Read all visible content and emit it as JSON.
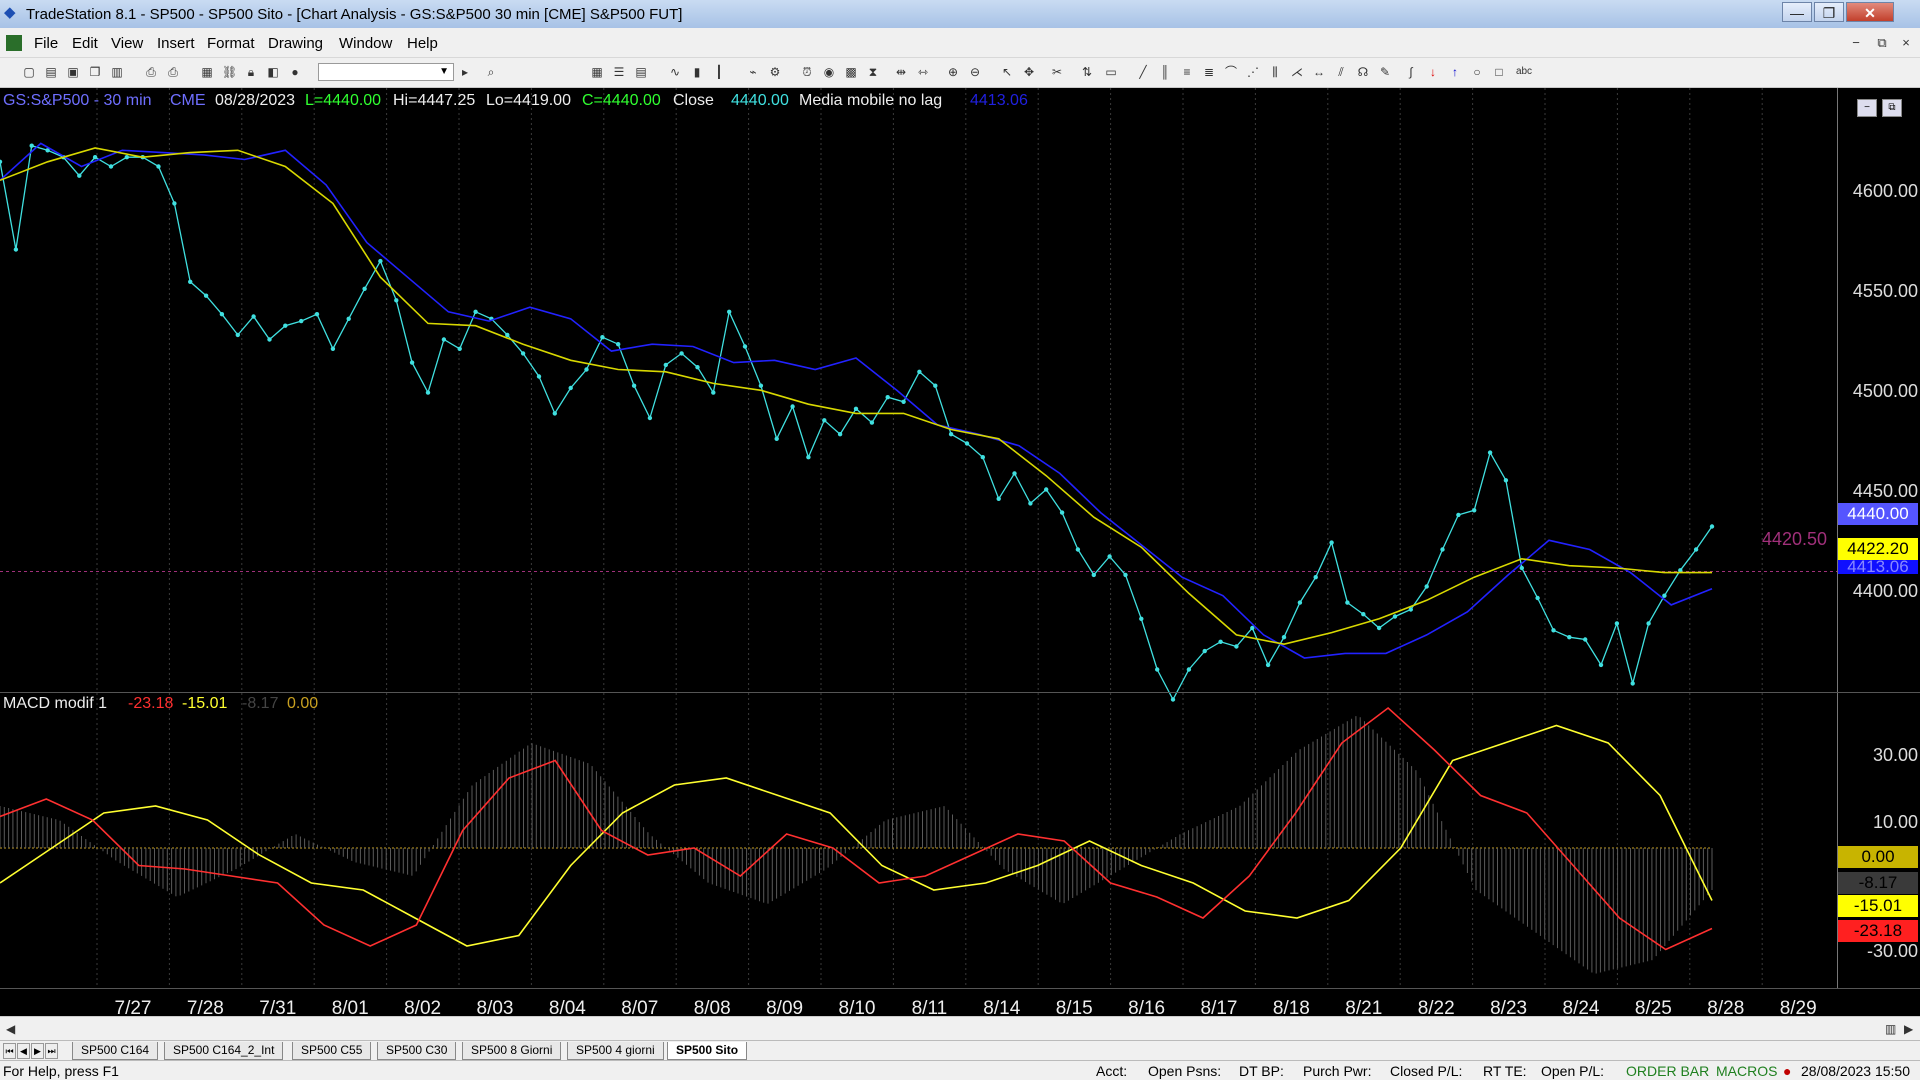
{
  "window": {
    "title": "TradeStation 8.1 - SP500 - SP500 Sito - [Chart Analysis - GS:S&P500  30 min  [CME] S&P500 FUT]",
    "controls": {
      "minimize": "—",
      "restore": "❐",
      "close": "✕"
    }
  },
  "menu": {
    "items": [
      "File",
      "Edit",
      "View",
      "Insert",
      "Format",
      "Drawing",
      "Window",
      "Help"
    ],
    "mdi_controls": [
      "−",
      "⧉",
      "×"
    ]
  },
  "toolbar": {
    "combo_value": ""
  },
  "chart_header": {
    "symbol": "GS:S&P500 - 30 min",
    "exchange": "CME",
    "date": "08/28/2023",
    "last": "L=4440.00",
    "high": "Hi=4447.25",
    "low": "Lo=4419.00",
    "close_val": "C=4440.00",
    "close_label": "Close",
    "close_num": "4440.00",
    "ma_label": "Media mobile no lag",
    "ma_value": "4413.06",
    "colors": {
      "symbol": "#6f6fff",
      "last": "#30ff30",
      "close_val": "#30ff30",
      "close_num": "#40e0e0",
      "ma_value": "#2020e0"
    }
  },
  "macd_header": {
    "name": "MACD modif 1",
    "macd": "-23.18",
    "signal": "-15.01",
    "hist": "-8.17",
    "zero": "0.00",
    "colors": {
      "macd": "#ff3030",
      "signal": "#ffff30",
      "hist": "#444444",
      "zero": "#c8a020"
    }
  },
  "price_axis": {
    "labels": [
      "4600.00",
      "4550.00",
      "4500.00",
      "4450.00",
      "4400.00"
    ],
    "boxes": {
      "last": "4440.00",
      "ma_slow": "4422.20",
      "ma_fast": "4413.06"
    },
    "marker": "4420.50"
  },
  "macd_axis": {
    "labels": [
      "30.00",
      "10.00",
      "-30.00"
    ],
    "boxes": {
      "zero": "0.00",
      "hist": "-8.17",
      "signal": "-15.01",
      "macd": "-23.18"
    }
  },
  "chart_data": {
    "type": "line",
    "x": [
      "7/27",
      "7/28",
      "7/31",
      "8/01",
      "8/02",
      "8/03",
      "8/04",
      "8/07",
      "8/08",
      "8/09",
      "8/10",
      "8/11",
      "8/14",
      "8/15",
      "8/16",
      "8/17",
      "8/18",
      "8/21",
      "8/22",
      "8/23",
      "8/24",
      "8/25",
      "8/28",
      "8/29"
    ],
    "ylim": [
      4370,
      4630
    ],
    "series": [
      {
        "name": "Close",
        "color": "#40e0e0",
        "values": [
          4598,
          4560,
          4605,
          4603,
          4600,
          4592,
          4600,
          4596,
          4600,
          4600,
          4596,
          4580,
          4546,
          4540,
          4532,
          4523,
          4531,
          4521,
          4527,
          4529,
          4532,
          4517,
          4530,
          4543,
          4555,
          4538,
          4511,
          4498,
          4521,
          4517,
          4533,
          4530,
          4523,
          4515,
          4505,
          4489,
          4500,
          4508,
          4522,
          4519,
          4501,
          4487,
          4510,
          4515,
          4509,
          4498,
          4533,
          4518,
          4501,
          4478,
          4492,
          4470,
          4486,
          4480,
          4491,
          4485,
          4496,
          4494,
          4507,
          4501,
          4480,
          4476,
          4470,
          4452,
          4463,
          4450,
          4456,
          4446,
          4430,
          4419,
          4427,
          4419,
          4400,
          4378,
          4365,
          4378,
          4386,
          4390,
          4388,
          4396,
          4380,
          4392,
          4407,
          4418,
          4433,
          4407,
          4402,
          4396,
          4401,
          4404,
          4414,
          4430,
          4445,
          4447,
          4472,
          4460,
          4422,
          4409,
          4395,
          4392,
          4391,
          4380,
          4398,
          4372,
          4398,
          4410,
          4421,
          4430,
          4440
        ]
      },
      {
        "name": "Media mobile no lag",
        "color": "#2222ff",
        "values": [
          4590,
          4606,
          4596,
          4603,
          4602,
          4601,
          4599,
          4603,
          4588,
          4563,
          4548,
          4533,
          4529,
          4535,
          4530,
          4516,
          4519,
          4518,
          4511,
          4512,
          4508,
          4513,
          4499,
          4484,
          4480,
          4475,
          4463,
          4446,
          4432,
          4418,
          4410,
          4393,
          4383,
          4385,
          4385,
          4393,
          4403,
          4419,
          4434,
          4430,
          4420,
          4406,
          4413
        ]
      },
      {
        "name": "",
        "color": "#d8d800",
        "values": [
          4590,
          4598,
          4604,
          4600,
          4602,
          4603,
          4596,
          4580,
          4548,
          4528,
          4527,
          4519,
          4512,
          4508,
          4507,
          4502,
          4499,
          4493,
          4489,
          4489,
          4482,
          4478,
          4462,
          4444,
          4431,
          4411,
          4393,
          4389,
          4394,
          4400,
          4408,
          4418,
          4426,
          4423,
          4422,
          4420,
          4420
        ]
      }
    ]
  },
  "macd_data": {
    "type": "line",
    "ylim": [
      -40,
      40
    ],
    "macd": [
      9,
      14,
      8,
      -5,
      -6,
      -8,
      -10,
      -22,
      -28,
      -22,
      5,
      20,
      25,
      5,
      -2,
      0,
      -8,
      4,
      0,
      -10,
      -8,
      -2,
      4,
      2,
      -10,
      -14,
      -20,
      -8,
      10,
      30,
      40,
      28,
      15,
      10,
      -5,
      -20,
      -29,
      -23
    ],
    "signal": [
      -10,
      0,
      10,
      12,
      8,
      -2,
      -10,
      -12,
      -20,
      -28,
      -25,
      -5,
      10,
      18,
      20,
      15,
      10,
      -5,
      -12,
      -10,
      -5,
      2,
      -5,
      -10,
      -18,
      -20,
      -15,
      0,
      25,
      30,
      35,
      30,
      15,
      -15
    ],
    "hist": [
      12,
      8,
      -4,
      -14,
      -6,
      4,
      -4,
      -8,
      18,
      30,
      24,
      4,
      -10,
      -16,
      -6,
      8,
      12,
      -6,
      -16,
      -6,
      4,
      12,
      28,
      38,
      22,
      -12,
      -24,
      -36,
      -32,
      -12
    ]
  },
  "tabs": [
    "SP500 C164",
    "SP500 C164_2_Int",
    "SP500 C55",
    "SP500 C30",
    "SP500 8 Giorni",
    "SP500 4 giorni",
    "SP500 Sito"
  ],
  "status": {
    "help": "For Help, press F1",
    "acct": "Acct:",
    "open_psns": "Open Psns:",
    "dt_bp": "DT BP:",
    "purch_pwr": "Purch Pwr:",
    "closed_pl": "Closed P/L:",
    "rt_te": "RT TE:",
    "open_pl": "Open P/L:",
    "order_bar": "ORDER BAR",
    "macros": "MACROS",
    "datetime": "28/08/2023 15:50"
  }
}
